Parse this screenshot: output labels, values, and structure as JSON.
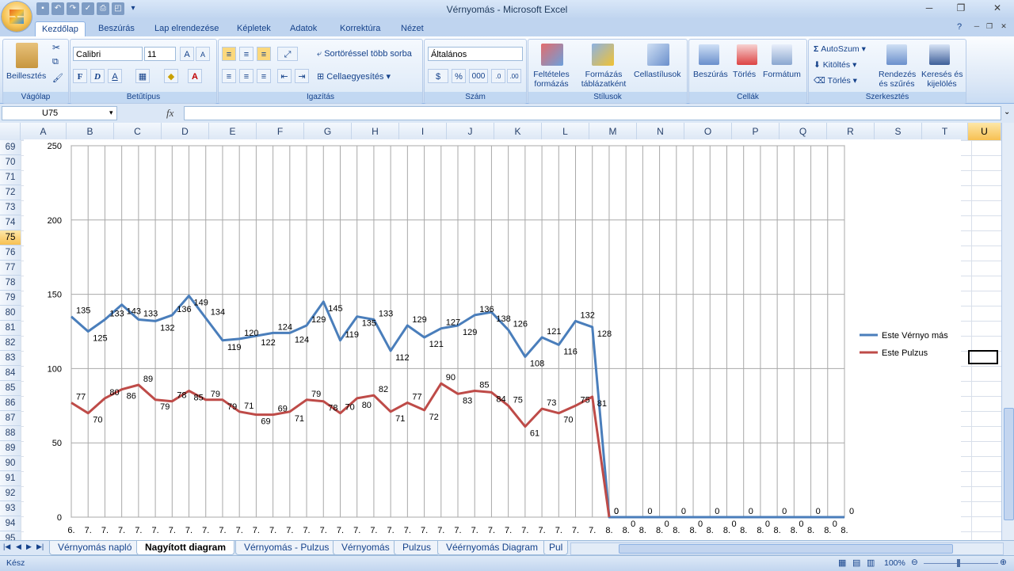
{
  "window": {
    "title": "Vérnyomás - Microsoft Excel"
  },
  "ribbon_tabs": [
    "Kezdőlap",
    "Beszúrás",
    "Lap elrendezése",
    "Képletek",
    "Adatok",
    "Korrektúra",
    "Nézet"
  ],
  "clipboard": {
    "paste": "Beillesztés",
    "group": "Vágólap"
  },
  "font": {
    "name": "Calibri",
    "size": "11",
    "bold": "F",
    "italic": "D",
    "underline": "A",
    "group": "Betűtípus"
  },
  "alignment": {
    "wrap": "Sortöréssel több sorba",
    "merge": "Cellaegyesítés",
    "group": "Igazítás"
  },
  "number": {
    "format": "Általános",
    "percent": "%",
    "thousands": "000",
    "group": "Szám"
  },
  "styles": {
    "cond_l1": "Feltételes",
    "cond_l2": "formázás",
    "table_l1": "Formázás",
    "table_l2": "táblázatként",
    "cell_styles": "Cellastílusok",
    "group": "Stílusok"
  },
  "cells": {
    "insert": "Beszúrás",
    "delete": "Törlés",
    "format": "Formátum",
    "group": "Cellák"
  },
  "editing": {
    "autosum": "AutoSzum",
    "fill": "Kitöltés",
    "clear": "Törlés",
    "sort_l1": "Rendezés",
    "sort_l2": "és szűrés",
    "find_l1": "Keresés és",
    "find_l2": "kijelölés",
    "group": "Szerkesztés"
  },
  "formula_bar": {
    "name_box": "U75",
    "fx": "fx",
    "content": ""
  },
  "columns": [
    "A",
    "B",
    "C",
    "D",
    "E",
    "F",
    "G",
    "H",
    "I",
    "J",
    "K",
    "L",
    "M",
    "N",
    "O",
    "P",
    "Q",
    "R",
    "S",
    "T",
    "U"
  ],
  "rows": [
    "69",
    "70",
    "71",
    "72",
    "73",
    "74",
    "75",
    "76",
    "77",
    "78",
    "79",
    "80",
    "81",
    "82",
    "83",
    "84",
    "85",
    "86",
    "87",
    "88",
    "89",
    "90",
    "91",
    "92",
    "93",
    "94",
    "95"
  ],
  "chart_data": {
    "type": "line",
    "ylim": [
      0,
      250
    ],
    "yticks": [
      0,
      50,
      100,
      150,
      200,
      250
    ],
    "x": [
      "6.",
      "7.",
      "7.",
      "7.",
      "7.",
      "7.",
      "7.",
      "7.",
      "7.",
      "7.",
      "7.",
      "7.",
      "7.",
      "7.",
      "7.",
      "7.",
      "7.",
      "7.",
      "7.",
      "7.",
      "7.",
      "7.",
      "7.",
      "7.",
      "7.",
      "7.",
      "7.",
      "7.",
      "7.",
      "7.",
      "7.",
      "7.",
      "8.",
      "8.",
      "8.",
      "8.",
      "8.",
      "8.",
      "8.",
      "8.",
      "8.",
      "8.",
      "8.",
      "8.",
      "8.",
      "8.",
      "8."
    ],
    "series": [
      {
        "name": "Este Vérnyo más",
        "color": "#4a7ebb",
        "values": [
          135,
          125,
          133,
          143,
          133,
          132,
          136,
          149,
          134,
          119,
          120,
          122,
          124,
          124,
          129,
          145,
          119,
          135,
          133,
          112,
          129,
          121,
          127,
          129,
          136,
          138,
          126,
          108,
          121,
          116,
          132,
          128,
          0,
          0,
          0,
          0,
          0,
          0,
          0,
          0,
          0,
          0,
          0,
          0,
          0,
          0,
          0
        ]
      },
      {
        "name": "Este Pulzus",
        "color": "#be4b48",
        "values": [
          77,
          70,
          80,
          86,
          89,
          79,
          78,
          85,
          79,
          79,
          71,
          69,
          69,
          71,
          79,
          78,
          70,
          80,
          82,
          71,
          77,
          72,
          90,
          83,
          85,
          84,
          75,
          61,
          73,
          70,
          75,
          81,
          0,
          null,
          null,
          null,
          null,
          null,
          null,
          null,
          null,
          null,
          null,
          null,
          null,
          null,
          null
        ]
      }
    ],
    "legend": "right"
  },
  "sheet_tabs": [
    "Vérnyomás napló",
    "Nagyított diagram",
    "Vérnyomás - Pulzus",
    "Vérnyomás",
    "Pulzus",
    "Véérnyomás Diagram",
    "Pul"
  ],
  "status": {
    "ready": "Kész",
    "zoom": "100%"
  }
}
